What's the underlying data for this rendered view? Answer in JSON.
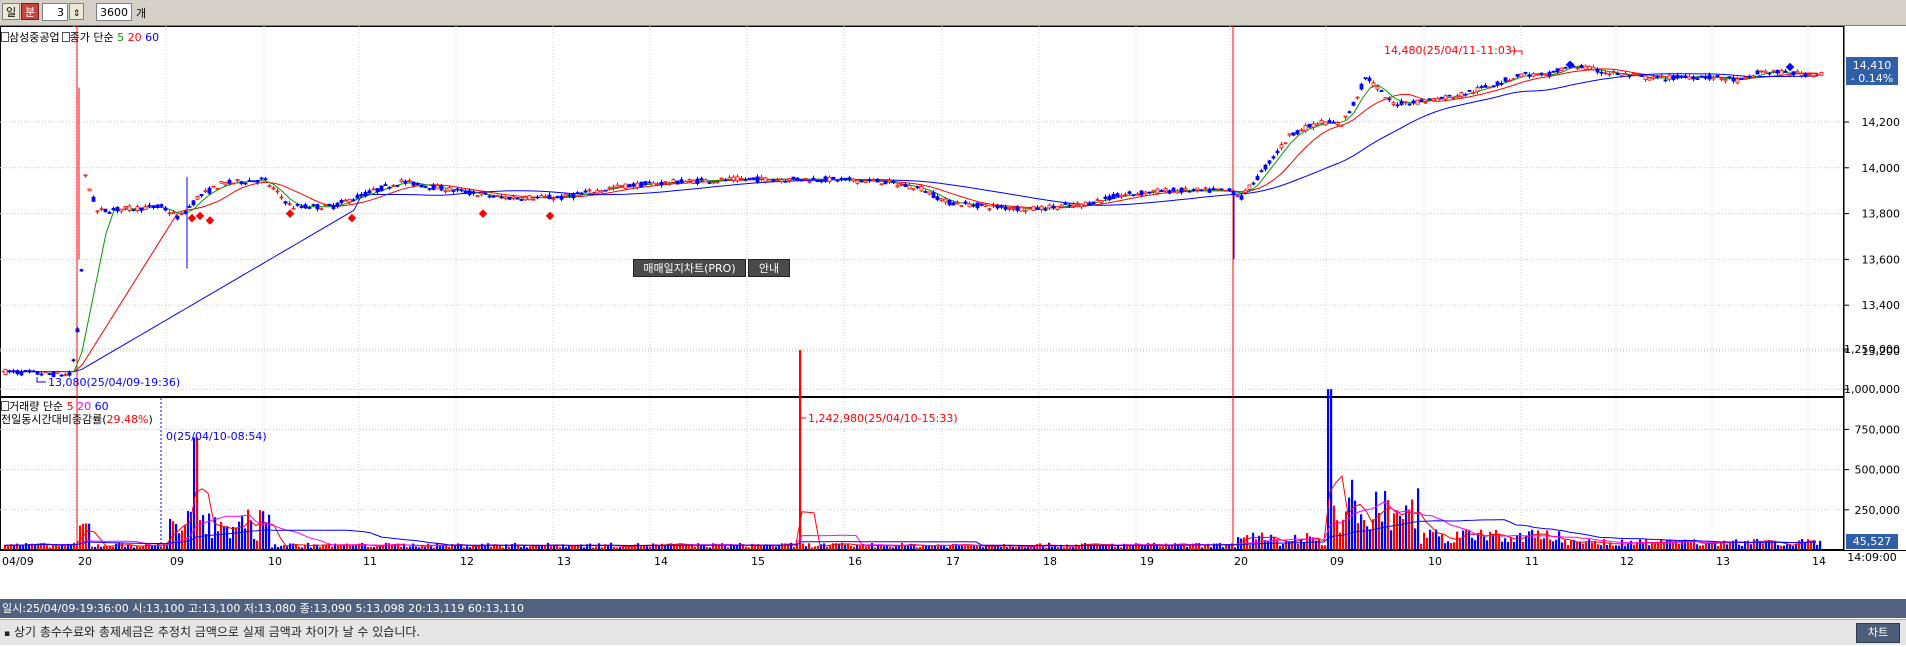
{
  "toolbar": {
    "period_day": "일",
    "period_minute": "분",
    "interval_value": "3",
    "count_value": "3600",
    "count_unit": "개"
  },
  "price_legend": {
    "stock_name": "삼성중공업",
    "series_label": "종가 단순",
    "ma5": "5",
    "ma20": "20",
    "ma60": "60"
  },
  "volume_legend": {
    "series_label": "거래량 단순",
    "ma5": "5",
    "ma20": "20",
    "ma60": "60",
    "ratio_label": "전일동시간대비증감률(",
    "ratio_value": "29.48%",
    "ratio_close": ")"
  },
  "annotations": {
    "high": "14,480(25/04/11-11:03)",
    "low": "13,080(25/04/09-19:36)",
    "vol_max": "1,242,980(25/04/10-15:33)",
    "vol_min": "0(25/04/10-08:54)"
  },
  "overlay": {
    "trade_chart": "매매일지차트(PRO)",
    "guide": "안내"
  },
  "price_axis": {
    "ticks": [
      "14,200",
      "14,000",
      "13,800",
      "13,600",
      "13,400",
      "13,200"
    ],
    "current_price": "14,410",
    "current_change": "- 0.14%"
  },
  "volume_axis": {
    "ticks": [
      "1,250,000",
      "1,000,000",
      "750,000",
      "500,000",
      "250,000"
    ],
    "current_volume": "45,527"
  },
  "time_axis": {
    "labels": [
      "04/09",
      "20",
      "09",
      "10",
      "11",
      "12",
      "13",
      "14",
      "15",
      "16",
      "17",
      "18",
      "19",
      "20",
      "09",
      "10",
      "11",
      "12",
      "13",
      "14"
    ],
    "right_time": "14:09:00"
  },
  "info_bar": "일시:25/04/09-19:36:00 시:13,100 고:13,100 저:13,080 종:13,090 5:13,098 20:13,119 60:13,110",
  "footer": {
    "notice": "상기 총수수료와 총제세금은 추정치 금액으로  실제 금액과 차이가 날 수 있습니다.",
    "chart_button": "차트"
  },
  "colors": {
    "up": "#ff0000",
    "down": "#0000ff",
    "ma5": "#009900",
    "ma20": "#ff0000",
    "ma60": "#0000ff",
    "vol_ma20": "#ff00ff",
    "info_bar": "#50627f"
  }
}
